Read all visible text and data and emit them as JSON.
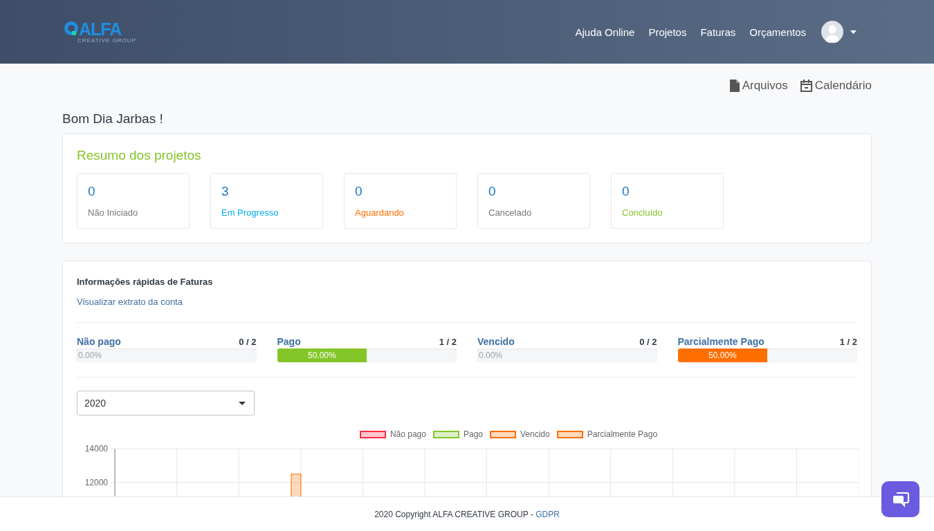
{
  "header": {
    "logo": {
      "name": "ALFA",
      "tagline": "CREATIVE GROUP"
    },
    "nav": [
      {
        "label": "Ajuda Online"
      },
      {
        "label": "Projetos"
      },
      {
        "label": "Faturas"
      },
      {
        "label": "Orçamentos"
      }
    ]
  },
  "quick_links": [
    {
      "kind": "file",
      "label": "Arquivos"
    },
    {
      "kind": "calendar",
      "label": "Calendário"
    }
  ],
  "greeting": "Bom Dia Jarbas !",
  "projects": {
    "title": "Resumo dos projetos",
    "stats": [
      {
        "count": "0",
        "label": "Não Iniciado",
        "color": "#777777"
      },
      {
        "count": "3",
        "label": "Em Progresso",
        "color": "#03a9f4"
      },
      {
        "count": "0",
        "label": "Aguardando",
        "color": "#ff6f00"
      },
      {
        "count": "0",
        "label": "Cancelado",
        "color": "#777777"
      },
      {
        "count": "0",
        "label": "Concluído",
        "color": "#84c529"
      }
    ]
  },
  "invoices": {
    "title": "Informações rápidas de Faturas",
    "link": "Visualizar extrato da conta",
    "bars": [
      {
        "label": "Não pago",
        "ratio": "0 / 2",
        "percent": "0.00%",
        "level": 0
      },
      {
        "label": "Pago",
        "ratio": "1 / 2",
        "percent": "50.00%",
        "level": 0.5,
        "color": "#84c529"
      },
      {
        "label": "Vencido",
        "ratio": "0 / 2",
        "percent": "0.00%",
        "level": 0
      },
      {
        "label": "Parcialmente Pago",
        "ratio": "1 / 2",
        "percent": "50.00%",
        "level": 0.5,
        "color": "#ff6f00"
      }
    ],
    "year": "2020",
    "chart_data": {
      "type": "bar",
      "ylim": [
        0,
        14000
      ],
      "yticks": [
        12000,
        14000
      ],
      "series": [
        {
          "name": "Não pago",
          "color": "#fc2d42",
          "values": [
            null,
            null,
            null,
            null,
            null,
            null,
            null,
            null,
            null,
            null,
            null,
            null
          ]
        },
        {
          "name": "Pago",
          "color": "#84c529",
          "values": [
            null,
            null,
            null,
            null,
            null,
            null,
            null,
            null,
            null,
            null,
            null,
            null
          ]
        },
        {
          "name": "Vencido",
          "color": "#ff6f00",
          "values": [
            null,
            null,
            null,
            null,
            null,
            null,
            null,
            null,
            null,
            null,
            null,
            null
          ]
        },
        {
          "name": "Parcialmente Pago",
          "color": "#ff6f00",
          "values": [
            null,
            null,
            12500,
            null,
            null,
            null,
            null,
            null,
            null,
            null,
            null,
            null
          ]
        }
      ]
    }
  },
  "footer": {
    "text": "2020 Copyright ALFA CREATIVE GROUP - ",
    "link": "GDPR"
  }
}
